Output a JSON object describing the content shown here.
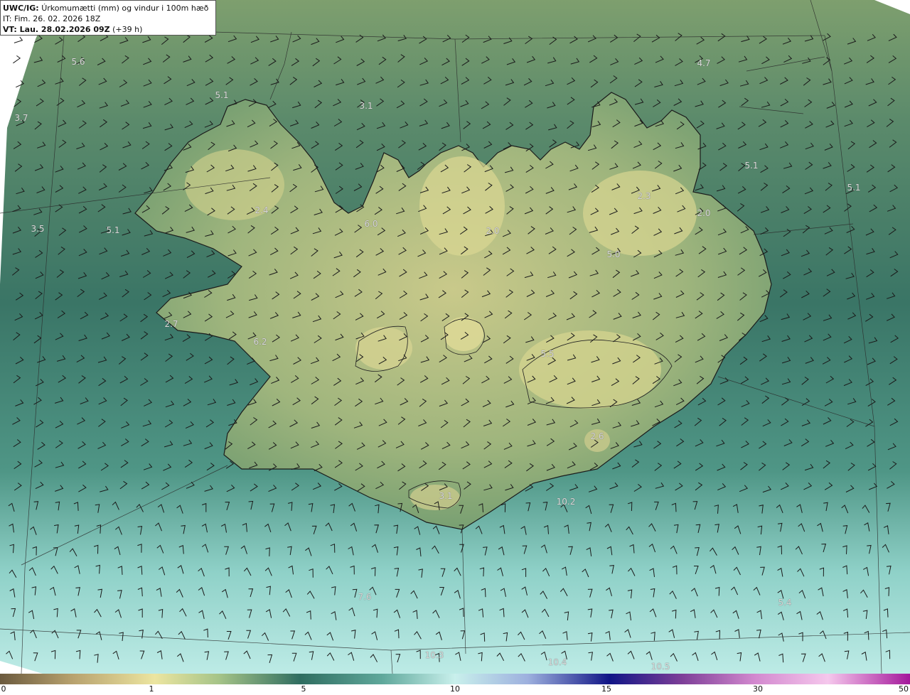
{
  "header": {
    "model": "UWC/IG:",
    "title": "Úrkomumætti (mm) og vindur i 100m hæð",
    "issue_time": "IT: Fim. 26. 02. 2026 18Z",
    "valid_prefix": "VT: Lau. 28.02.2026 09Z",
    "valid_suffix": "(+39 h)"
  },
  "value_labels": [
    "5.6",
    "3.7",
    "5.1",
    "3.1",
    "4.7",
    "5.1",
    "5.1",
    "2.3",
    "2.0",
    "6.0",
    "2.0",
    "5.0",
    "2.4",
    "3.5",
    "5.1",
    "2.7",
    "6.2",
    "5.5",
    "2.6",
    "3.1",
    "10.2",
    "7.6",
    "10.3",
    "10.4",
    "10.5",
    "5.4"
  ],
  "colorbar": {
    "ticks": [
      "0",
      "1",
      "5",
      "10",
      "15",
      "30",
      "50"
    ],
    "colors": [
      "#6b5a3e",
      "#c6b37a",
      "#e9df97",
      "#6f9a78",
      "#2f6d60",
      "#5fa89b",
      "#c8f0ee",
      "#ddeaf5",
      "#6d7fc4",
      "#161a8a",
      "#7a3f95",
      "#cf7fc9",
      "#f7c8ee",
      "#a41a9a"
    ]
  },
  "colors": {
    "sea": "#2f6d62",
    "shelf": "#3f8070",
    "south_sea": "#8fd3cc",
    "highland": "#d9d595",
    "land": "#8fb27c"
  }
}
